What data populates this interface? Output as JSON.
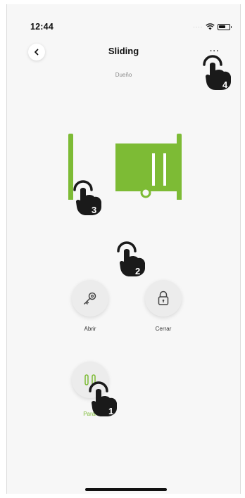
{
  "status_bar": {
    "time": "12:44",
    "icons": [
      "signal-dots",
      "wifi-icon",
      "battery-icon"
    ]
  },
  "header": {
    "title": "Sliding",
    "subtitle": "Dueño",
    "back_icon": "chevron-left-icon",
    "more_icon": "more-dots-icon",
    "more_label": "···"
  },
  "gate": {
    "color": "#7dbb35",
    "state_icon": "sliding-gate-icon"
  },
  "controls": {
    "open": {
      "label": "Abrir",
      "icon": "key-icon"
    },
    "close": {
      "label": "Cerrar",
      "icon": "lock-icon"
    },
    "stop": {
      "label": "Parar",
      "icon": "pause-icon",
      "color": "#7dbb35"
    }
  },
  "callouts": [
    {
      "number": "1",
      "target": "stop-button"
    },
    {
      "number": "2",
      "target": "gate-area"
    },
    {
      "number": "3",
      "target": "gate-post"
    },
    {
      "number": "4",
      "target": "more-button"
    }
  ],
  "colors": {
    "accent": "#7dbb35",
    "background": "#f7f7f7",
    "callout": "#1a1a1a"
  }
}
